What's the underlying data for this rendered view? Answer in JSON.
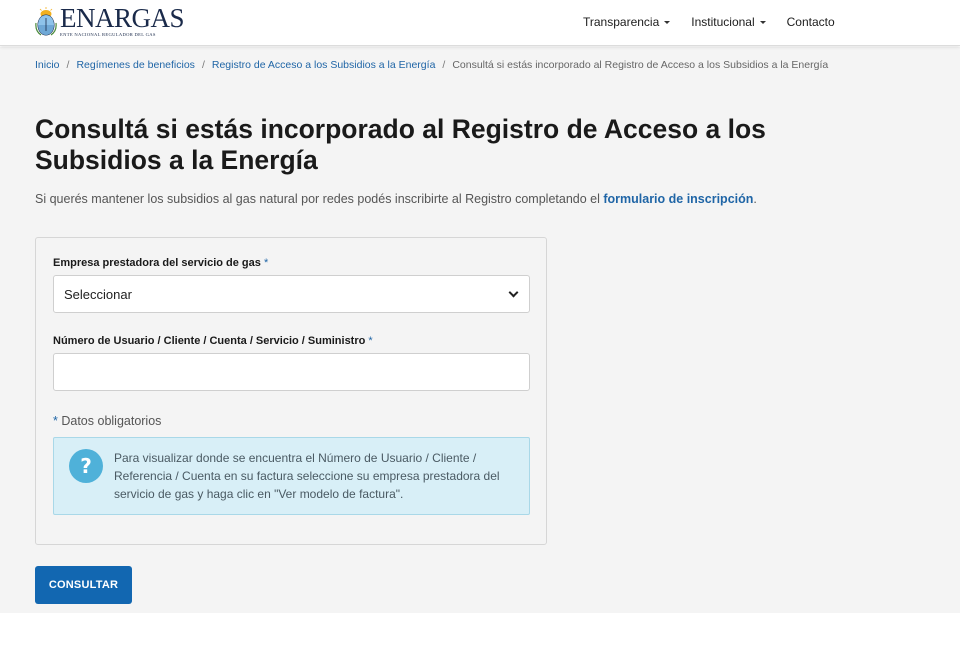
{
  "header": {
    "logo_name": "ENARGAS",
    "logo_subtitle": "ENTE NACIONAL REGULADOR DEL GAS",
    "nav": [
      {
        "label": "Transparencia",
        "has_dropdown": true
      },
      {
        "label": "Institucional",
        "has_dropdown": true
      },
      {
        "label": "Contacto",
        "has_dropdown": false
      }
    ]
  },
  "breadcrumb": {
    "items": [
      "Inicio",
      "Regímenes de beneficios",
      "Registro de Acceso a los Subsidios a la Energía"
    ],
    "separator": "/",
    "current": "Consultá si estás incorporado al Registro de Acceso a los Subsidios a la Energía"
  },
  "main": {
    "title": "Consultá si estás incorporado al Registro de Acceso a los Subsidios a la Energía",
    "lead_text": "Si querés mantener los subsidios al gas natural por redes podés inscribirte al Registro completando el ",
    "lead_link": "formulario de inscripción",
    "lead_end": "."
  },
  "form": {
    "company_label": "Empresa prestadora del servicio de gas",
    "required_mark": "*",
    "company_value": "Seleccionar",
    "user_number_label": "Número de Usuario / Cliente / Cuenta / Servicio / Suministro",
    "user_number_value": "",
    "mandatory_note": "Datos obligatorios",
    "info_icon_glyph": "?",
    "info_text": "Para visualizar donde se encuentra el Número de Usuario / Cliente / Referencia / Cuenta en su factura seleccione su empresa prestadora del servicio de gas y haga clic en \"Ver modelo de factura\".",
    "submit_label": "CONSULTAR"
  },
  "colors": {
    "link": "#1f65a6",
    "button": "#1267b1",
    "info_bg": "#d8eff7",
    "info_icon": "#4fb1d9",
    "page_bg": "#f4f4f4"
  },
  "icons": {
    "logo": "argentina-coat-of-arms-icon",
    "nav_dropdown": "caret-down-icon",
    "select_dropdown": "chevron-down-icon",
    "info": "question-circle-icon"
  }
}
